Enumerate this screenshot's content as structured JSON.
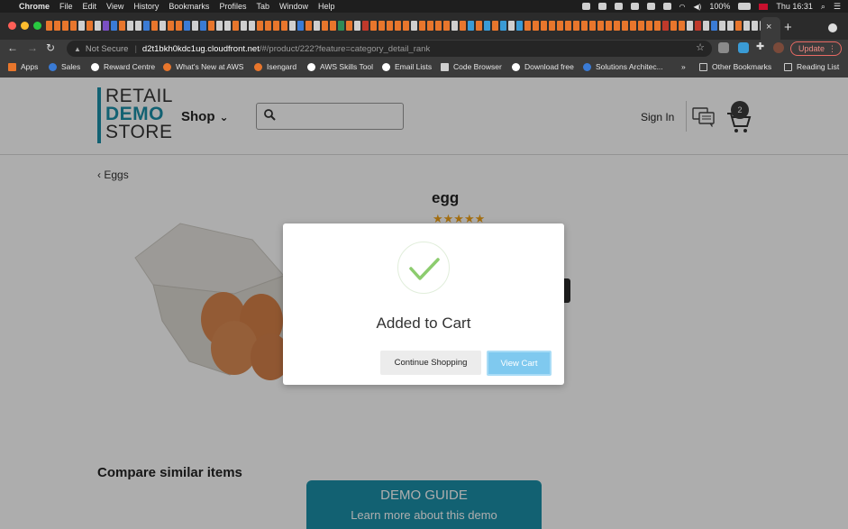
{
  "menubar": {
    "app_name": "Chrome",
    "items": [
      "File",
      "Edit",
      "View",
      "History",
      "Bookmarks",
      "Profiles",
      "Tab",
      "Window",
      "Help"
    ],
    "battery": "100%",
    "clock": "Thu 16:31"
  },
  "tabs": {
    "close_glyph": "×",
    "new_tab_glyph": "+",
    "favicon_colors": [
      "#e8762c",
      "#e8762c",
      "#e8762c",
      "#e8762c",
      "#cfcfcf",
      "#e8762c",
      "#cfcfcf",
      "#7a4fc4",
      "#3a7bd5",
      "#e8762c",
      "#cfcfcf",
      "#cfcfcf",
      "#3a7bd5",
      "#e8762c",
      "#cfcfcf",
      "#e8762c",
      "#e8762c",
      "#3a7bd5",
      "#cfcfcf",
      "#3a7bd5",
      "#e8762c",
      "#cfcfcf",
      "#cfcfcf",
      "#e8762c",
      "#cfcfcf",
      "#cfcfcf",
      "#e8762c",
      "#e8762c",
      "#e8762c",
      "#e8762c",
      "#cfcfcf",
      "#3a7bd5",
      "#e8762c",
      "#cfcfcf",
      "#e8762c",
      "#e8762c",
      "#2e8b57",
      "#e8762c",
      "#cfcfcf",
      "#c0392b",
      "#e8762c",
      "#e8762c",
      "#e8762c",
      "#e8762c",
      "#e8762c",
      "#cfcfcf",
      "#e8762c",
      "#e8762c",
      "#e8762c",
      "#e8762c",
      "#cfcfcf",
      "#e8762c",
      "#3a9bd5",
      "#e8762c",
      "#3a9bd5",
      "#e8762c",
      "#3a9bd5",
      "#cfcfcf",
      "#3a9bd5",
      "#e8762c",
      "#e8762c",
      "#e8762c",
      "#e8762c",
      "#e8762c",
      "#e8762c",
      "#e8762c",
      "#e8762c",
      "#e8762c",
      "#e8762c",
      "#e8762c",
      "#e8762c",
      "#e8762c",
      "#e8762c",
      "#e8762c",
      "#e8762c",
      "#e8762c",
      "#c0392b",
      "#e8762c",
      "#e8762c",
      "#cfcfcf",
      "#c0392b",
      "#cfcfcf",
      "#3a7bd5",
      "#cfcfcf",
      "#cfcfcf",
      "#e8762c",
      "#cfcfcf",
      "#cfcfcf",
      "#cfcfcf"
    ]
  },
  "address_bar": {
    "security": "Not Secure",
    "host": "d2t1bkh0kdc1ug.cloudfront.net",
    "path": "/#/product/222?feature=category_detail_rank"
  },
  "update_button": "Update",
  "bookmarks": {
    "items": [
      {
        "label": "Apps",
        "icon": "apps-grid-icon",
        "color": "#e8762c"
      },
      {
        "label": "Sales",
        "icon": "globe-icon",
        "color": "#3a7bd5"
      },
      {
        "label": "Reward Centre",
        "icon": "globe-icon",
        "color": "#ffffff"
      },
      {
        "label": "What's New at AWS",
        "icon": "aws-icon",
        "color": "#e8762c"
      },
      {
        "label": "Isengard",
        "icon": "isengard-icon",
        "color": "#e8762c"
      },
      {
        "label": "AWS Skills Tool",
        "icon": "globe-icon",
        "color": "#ffffff"
      },
      {
        "label": "Email Lists",
        "icon": "globe-icon",
        "color": "#ffffff"
      },
      {
        "label": "Code Browser",
        "icon": "page-icon",
        "color": "#cfcfcf"
      },
      {
        "label": "Download free",
        "icon": "globe-icon",
        "color": "#ffffff"
      },
      {
        "label": "Solutions Architec...",
        "icon": "globe-icon",
        "color": "#3a7bd5"
      }
    ],
    "overflow": "»",
    "other_bookmarks": "Other Bookmarks",
    "reading_list": "Reading List"
  },
  "site": {
    "logo": {
      "line1": "RETAIL",
      "line2": "DEMO",
      "line3": "STORE"
    },
    "shop_label": "Shop",
    "sign_in": "Sign In",
    "cart_count": "2",
    "accent_color": "#1b8fa8"
  },
  "product": {
    "back_label": "Eggs",
    "name": "egg",
    "rating_stars": 5,
    "rating_glyphs": "★★★★★"
  },
  "compare_title": "Compare similar items",
  "demo_guide": {
    "title": "DEMO GUIDE",
    "subtitle": "Learn more about this demo"
  },
  "modal": {
    "title": "Added to Cart",
    "continue_label": "Continue Shopping",
    "view_cart_label": "View Cart",
    "check_color": "#8ccc6e"
  }
}
